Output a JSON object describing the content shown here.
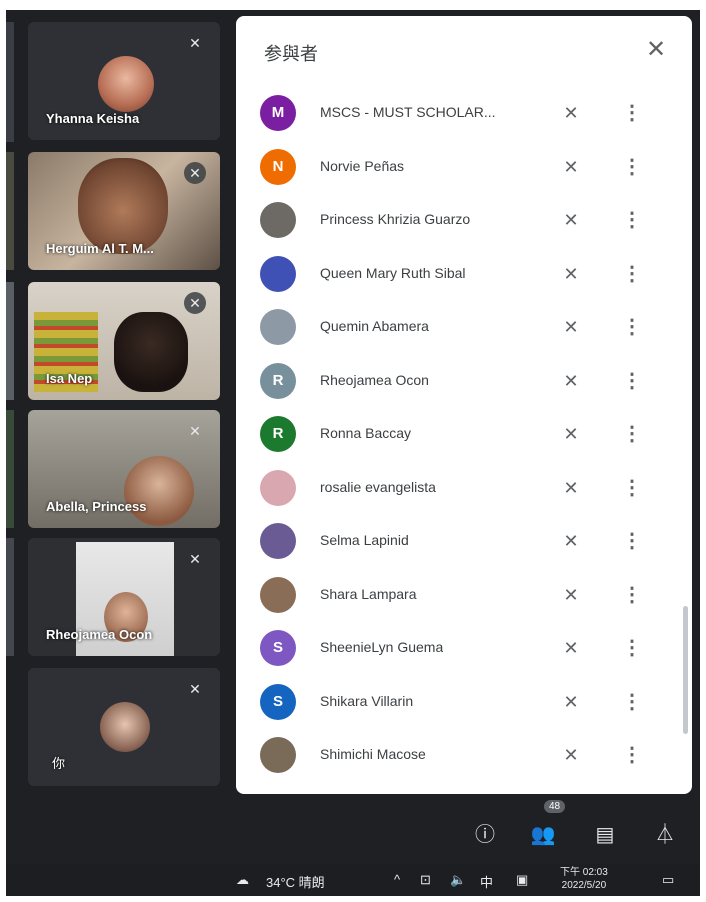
{
  "video_tiles": [
    {
      "name": "Yhanna Keisha",
      "muted": true
    },
    {
      "name": "Herguim Al T. M...",
      "muted": true
    },
    {
      "name": "Isa Nep",
      "muted": true
    },
    {
      "name": "Abella, Princess",
      "muted": true
    },
    {
      "name": "Rheojamea Ocon",
      "muted": true
    },
    {
      "name": "你",
      "muted": true
    }
  ],
  "panel": {
    "title": "参與者",
    "participants": [
      {
        "name": "MSCS - MUST SCHOLAR...",
        "initial": "M",
        "color": "#7b1fa2"
      },
      {
        "name": "Norvie Peñas",
        "initial": "N",
        "color": "#ef6c00"
      },
      {
        "name": "Princess Khrizia Guarzo",
        "initial": "",
        "color": "#6d6a66"
      },
      {
        "name": "Queen Mary Ruth Sibal",
        "initial": "",
        "color": "#3f51b5"
      },
      {
        "name": "Quemin Abamera",
        "initial": "",
        "color": "#8d9aa6"
      },
      {
        "name": "Rheojamea Ocon",
        "initial": "R",
        "color": "#78909c"
      },
      {
        "name": "Ronna Baccay",
        "initial": "R",
        "color": "#1b7a2e"
      },
      {
        "name": "rosalie evangelista",
        "initial": "",
        "color": "#d9a7b0"
      },
      {
        "name": "Selma Lapinid",
        "initial": "",
        "color": "#6b5b95"
      },
      {
        "name": "Shara Lampara",
        "initial": "",
        "color": "#8a6d56"
      },
      {
        "name": "SheenieLyn Guema",
        "initial": "S",
        "color": "#7e57c2"
      },
      {
        "name": "Shikara Villarin",
        "initial": "S",
        "color": "#1565c0"
      },
      {
        "name": "Shimichi Macose",
        "initial": "",
        "color": "#7a6a58"
      }
    ]
  },
  "controls": {
    "participant_count": "48"
  },
  "taskbar": {
    "weather": "34°C 晴朗",
    "ime": "中",
    "time": "下午 02:03",
    "date": "2022/5/20"
  }
}
